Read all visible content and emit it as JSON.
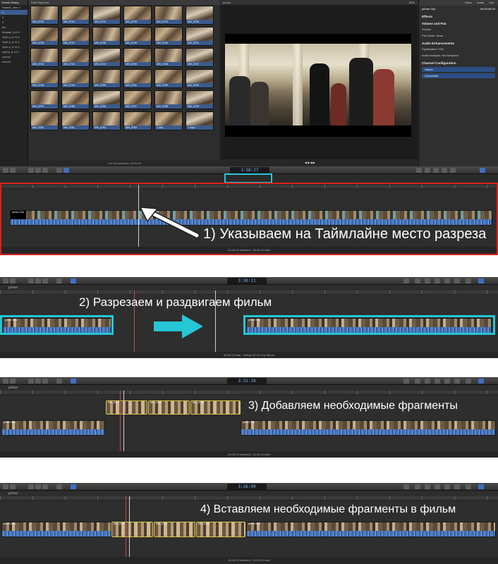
{
  "library": {
    "title": "Event Library",
    "items": [
      "Новый_олег 1",
      "1",
      "2",
      "3",
      "tbc",
      "Mogaal_s14.0",
      "Sprit a_d 14.1",
      "Sprit a_d 14.1",
      "Sprit a_d 14.1",
      "optimi_d 14.1",
      "zoom1",
      "zoom2"
    ]
  },
  "browser": {
    "header": "Hide Rejected",
    "clips": [
      "MVI_6730",
      "MVI_6731",
      "MVI_6732",
      "MVI_6733",
      "MVI_6734",
      "MVI_6735",
      "MVI_6736",
      "MVI_6737",
      "MVI_6738",
      "MVI_6739",
      "MVI_6740",
      "MVI_6741",
      "MVI_6742",
      "MVI_6743",
      "MVI_6744",
      "MVI_6745",
      "MVI_6746",
      "MVI_6747",
      "MVI_6748",
      "MVI_6749",
      "MVI_6750",
      "MVI_6751",
      "MVI_6752",
      "MVI_6753",
      "MVI_6754",
      "MVI_6755",
      "MVI_6756",
      "MVI_6757",
      "MVI_6758",
      "MVI_6759",
      "MVI_6760",
      "MVI_6761",
      "MVI_6762",
      "MVI_6763",
      "1 Clip",
      "1 Clip 1"
    ],
    "footer": "1 of 126 selected, 00:00:15"
  },
  "viewer": {
    "title": "primer",
    "zoom": "88%"
  },
  "inspector": {
    "tabs": [
      "Video",
      "Audio",
      "Info"
    ],
    "clip_name": "primer Clip",
    "timecode": "00:00:46:29",
    "sections": [
      "Effects",
      "Volume and Pan",
      "Audio Enhancements",
      "Channel Configuration"
    ],
    "rows": [
      "Volume",
      "Pan Mode:  None",
      "Equalization:  Flat",
      "Audio Analysis:  Not Analyzed"
    ],
    "channels": [
      "Stereo",
      "Connected"
    ]
  },
  "timecodes": {
    "s1": "3:58:27",
    "s2": "3:30:11",
    "s3": "3:31:18",
    "s4": "3:26:09"
  },
  "project_name": "primer",
  "clip_label": "primer Clip",
  "inserted_clips": [
    "MVI_6745",
    "MVI_6746",
    "MVI_6748"
  ],
  "footers": {
    "s1": "00:42:29 selected - 00:42:29 total",
    "s2": "00:00:14 total - 1080p HD 29.97p Stereo",
    "s3": "00:10:03 selected - 01:00:14 total",
    "s4": "00:10:03 selected - 01:00:14 total"
  },
  "captions": {
    "step1": "1) Указываем на Таймлайне место разреза",
    "step2": "2) Разрезаем и раздвигаем фильм",
    "step3": "3) Добавляем необходимые фрагменты",
    "step4": "4) Вставляем необходимые фрагменты в фильм"
  },
  "colors": {
    "highlight_cyan": "#25c6d6",
    "highlight_red": "#d6241b",
    "selection_blue": "#3b5b8f",
    "clip_outline_yellow": "#d8c84a"
  }
}
